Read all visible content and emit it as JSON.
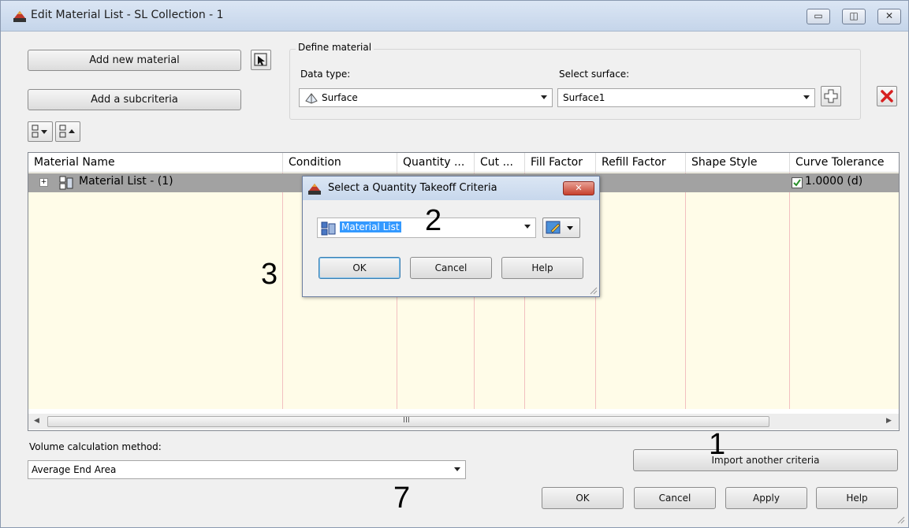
{
  "window": {
    "title": "Edit Material List - SL Collection - 1"
  },
  "toolbar": {
    "add_material_label": "Add new material",
    "add_subcriteria_label": "Add a subcriteria"
  },
  "define": {
    "legend": "Define material",
    "data_type_label": "Data type:",
    "data_type_value": "Surface",
    "select_surface_label": "Select surface:",
    "select_surface_value": "Surface1"
  },
  "grid": {
    "columns": [
      "Material Name",
      "Condition",
      "Quantity ...",
      "Cut ...",
      "Fill Factor",
      "Refill Factor",
      "Shape Style",
      "Curve Tolerance"
    ],
    "rows": [
      {
        "name": "Material List - (1)",
        "curve_tolerance": "1.0000 (d)"
      }
    ],
    "scroll_grip": "III"
  },
  "volume": {
    "label": "Volume calculation method:",
    "value": "Average End Area"
  },
  "footer": {
    "import_label": "Import another criteria",
    "ok_label": "OK",
    "cancel_label": "Cancel",
    "apply_label": "Apply",
    "help_label": "Help"
  },
  "dialog": {
    "title": "Select a Quantity Takeoff Criteria",
    "criteria_value": "Material List",
    "ok_label": "OK",
    "cancel_label": "Cancel",
    "help_label": "Help"
  },
  "annotations": [
    "1",
    "2",
    "3",
    "7"
  ],
  "colors": {
    "selection": "#3399ff",
    "grid_body": "#fffce8",
    "selected_row": "#a2a2a2",
    "delete_red": "#d62020"
  }
}
